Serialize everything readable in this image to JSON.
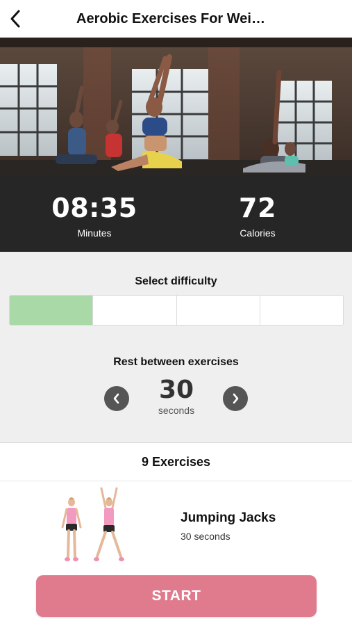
{
  "header": {
    "title": "Aerobic Exercises For Wei…",
    "back_icon": "chevron-left-icon"
  },
  "stats": {
    "minutes_value": "08:35",
    "minutes_label": "Minutes",
    "calories_value": "72",
    "calories_label": "Calories"
  },
  "difficulty": {
    "title": "Select difficulty",
    "levels": 4,
    "selected_level": 1,
    "selected_color": "#a8d9a6"
  },
  "rest": {
    "title": "Rest between exercises",
    "value": "30",
    "unit": "seconds",
    "prev_icon": "chevron-left-icon",
    "next_icon": "chevron-right-icon"
  },
  "exercises": {
    "header": "9 Exercises",
    "items": [
      {
        "name": "Jumping Jacks",
        "duration": "30 seconds"
      }
    ]
  },
  "start": {
    "label": "START",
    "color": "#e07a8d"
  }
}
